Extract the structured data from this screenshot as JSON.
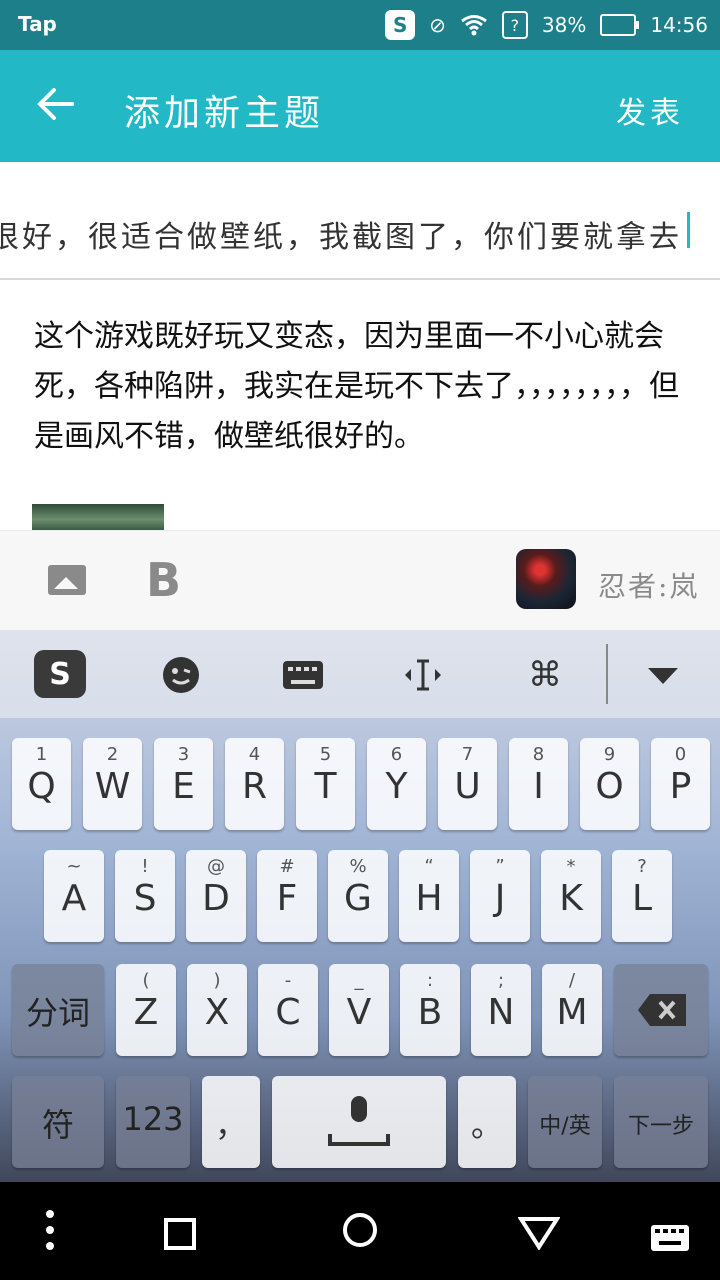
{
  "status_bar": {
    "app_label": "Tap",
    "battery": "38%",
    "time": "14:56",
    "icons": [
      "sogou-input-icon",
      "do-not-disturb-icon",
      "wifi-icon",
      "unknown-sim-icon",
      "battery-icon"
    ]
  },
  "header": {
    "back_icon": "arrow-left-icon",
    "title": "添加新主题",
    "publish_label": "发表"
  },
  "title_field": {
    "value": "很好，很适合做壁纸，我截图了，你们要就拿去"
  },
  "content": {
    "body": "这个游戏既好玩又变态，因为里面一不小心就会死，各种陷阱，我实在是玩不下去了，，，，，，，，但是画风不错，做壁纸很好的。"
  },
  "toolbar": {
    "image_icon": "image-icon",
    "bold_label": "B",
    "game_name": "忍者:岚"
  },
  "keyboard": {
    "toolbar_icons": [
      "sogou-logo-icon",
      "emoji-icon",
      "keyboard-icon",
      "cursor-move-icon",
      "command-icon",
      "collapse-icon"
    ],
    "row1": [
      {
        "sub": "1",
        "main": "Q"
      },
      {
        "sub": "2",
        "main": "W"
      },
      {
        "sub": "3",
        "main": "E"
      },
      {
        "sub": "4",
        "main": "R"
      },
      {
        "sub": "5",
        "main": "T"
      },
      {
        "sub": "6",
        "main": "Y"
      },
      {
        "sub": "7",
        "main": "U"
      },
      {
        "sub": "8",
        "main": "I"
      },
      {
        "sub": "9",
        "main": "O"
      },
      {
        "sub": "0",
        "main": "P"
      }
    ],
    "row2": [
      {
        "sub": "~",
        "main": "A"
      },
      {
        "sub": "!",
        "main": "S"
      },
      {
        "sub": "@",
        "main": "D"
      },
      {
        "sub": "#",
        "main": "F"
      },
      {
        "sub": "%",
        "main": "G"
      },
      {
        "sub": "“",
        "main": "H"
      },
      {
        "sub": "”",
        "main": "J"
      },
      {
        "sub": "*",
        "main": "K"
      },
      {
        "sub": "?",
        "main": "L"
      }
    ],
    "row3": [
      {
        "sub": "(",
        "main": "Z"
      },
      {
        "sub": ")",
        "main": "X"
      },
      {
        "sub": "-",
        "main": "C"
      },
      {
        "sub": "_",
        "main": "V"
      },
      {
        "sub": ":",
        "main": "B"
      },
      {
        "sub": ";",
        "main": "N"
      },
      {
        "sub": "/",
        "main": "M"
      }
    ],
    "segment_label": "分词",
    "symbol_label": "符",
    "numbers_label": "123",
    "comma_label": "，",
    "period_label": "。",
    "lang_label": "中/英",
    "next_label": "下一步"
  },
  "nav_bar": {
    "icons": [
      "menu-dots-icon",
      "square-icon",
      "circle-home-icon",
      "triangle-back-icon",
      "keyboard-hide-icon"
    ]
  }
}
